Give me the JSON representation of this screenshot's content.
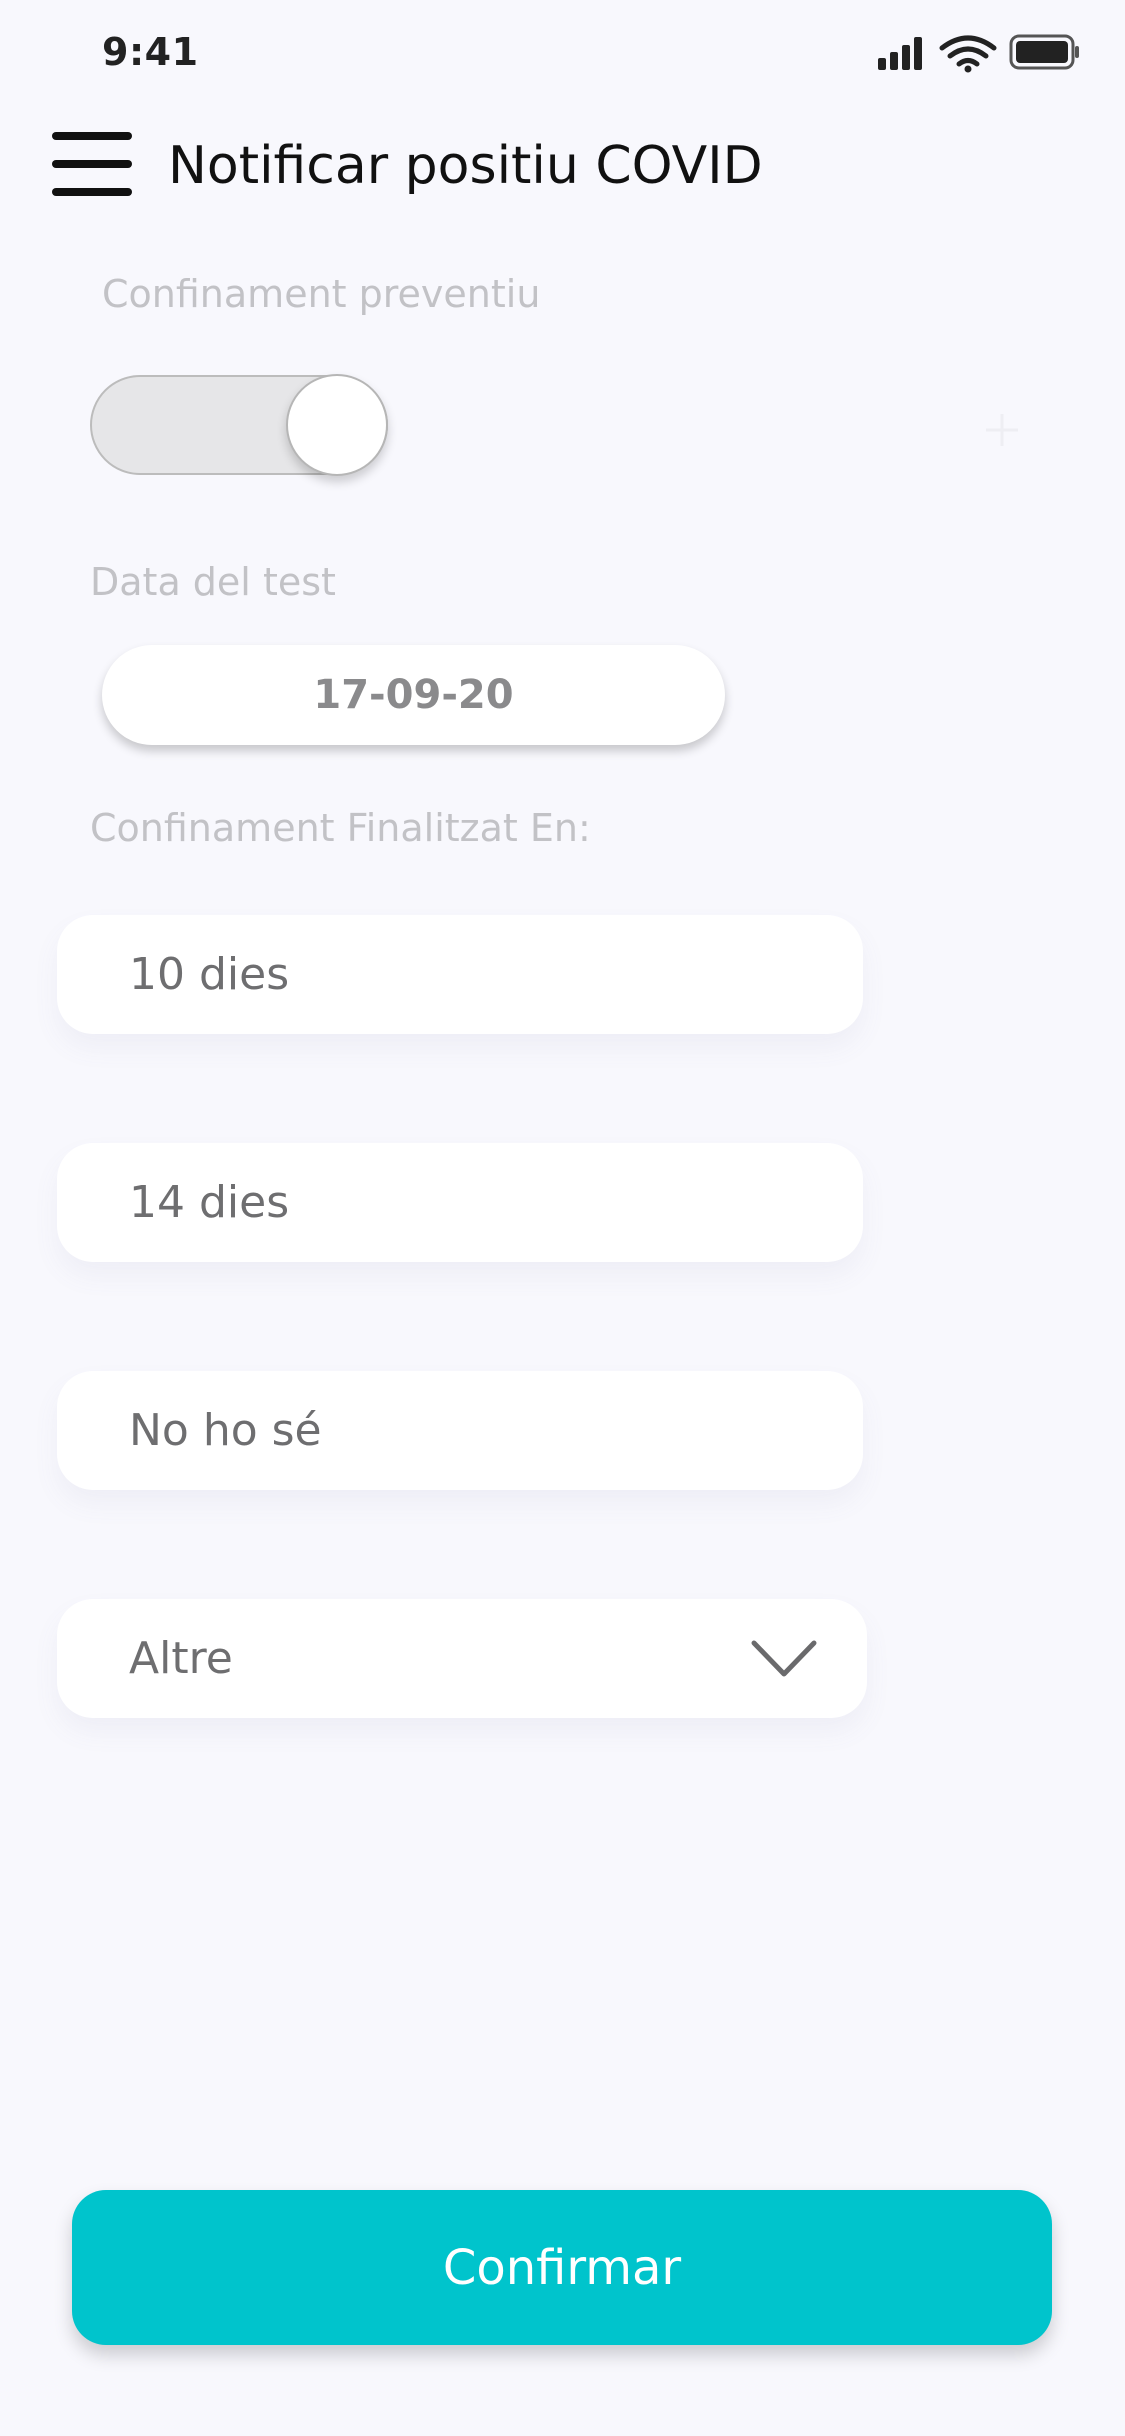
{
  "status_bar": {
    "time": "9:41",
    "icons": [
      "signal-icon",
      "wifi-icon",
      "battery-icon"
    ]
  },
  "header": {
    "menu_icon": "hamburger-menu-icon",
    "title": "Notificar positiu COVID"
  },
  "preventive": {
    "label": "Confinament preventiu",
    "toggle_on": true
  },
  "test_date": {
    "label": "Data del test",
    "value": "17-09-20"
  },
  "end": {
    "label": "Confinament Finalitzat En:",
    "options": [
      "10 dies",
      "14 dies",
      "No ho sé",
      "Altre"
    ]
  },
  "confirm_label": "Confirmar",
  "colors": {
    "accent": "#00c4cc",
    "background": "#f8f8fd",
    "muted_label": "#c2c2c6"
  }
}
